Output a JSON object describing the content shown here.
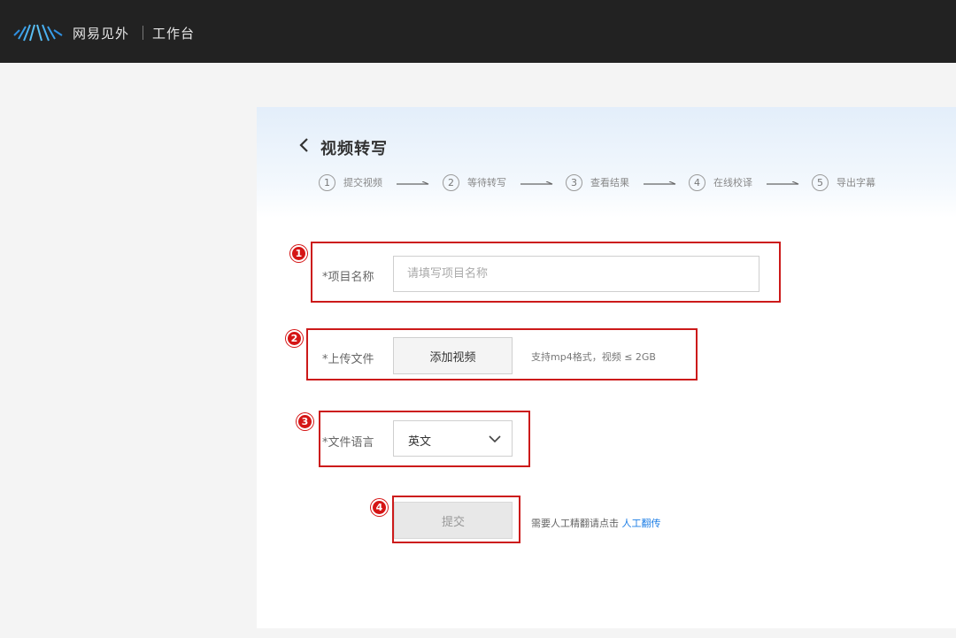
{
  "header": {
    "brand": "网易见外",
    "workbench": "工作台",
    "logo_icon": "waveform-logo-icon"
  },
  "page": {
    "title": "视频转写",
    "back_icon": "chevron-left-icon"
  },
  "steps": [
    {
      "num": "1",
      "label": "提交视频"
    },
    {
      "num": "2",
      "label": "等待转写"
    },
    {
      "num": "3",
      "label": "查看结果"
    },
    {
      "num": "4",
      "label": "在线校译"
    },
    {
      "num": "5",
      "label": "导出字幕"
    }
  ],
  "form": {
    "project_name": {
      "label": "*项目名称",
      "placeholder": "请填写项目名称",
      "value": ""
    },
    "upload": {
      "label": "*上传文件",
      "button": "添加视频",
      "hint": "支持mp4格式，视频 ≤ 2GB"
    },
    "language": {
      "label": "*文件语言",
      "selected": "英文"
    },
    "submit": {
      "button": "提交",
      "hint_prefix": "需要人工精翻请点击",
      "link": "人工翻传"
    }
  },
  "annotations": [
    "1",
    "2",
    "3",
    "4"
  ],
  "colors": {
    "topbar": "#222222",
    "accent_link": "#1f7fe6",
    "annotation": "#cc1a1a",
    "panel_header": "#e3eefa"
  }
}
